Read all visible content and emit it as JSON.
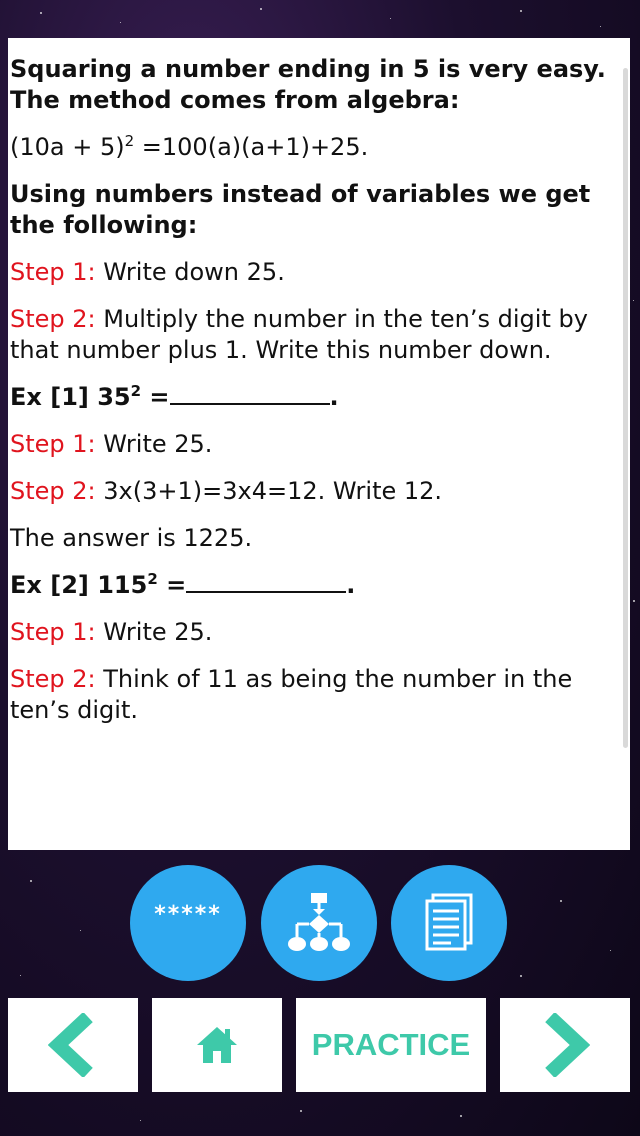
{
  "lesson": {
    "intro": "Squaring a number ending in 5 is very easy. The method comes from algebra:",
    "formula": {
      "lhs": "(10a + 5)",
      "exp": "2",
      "rhs": " =100(a)(a+1)+25."
    },
    "using_numbers": "Using numbers instead of variables we get the following:",
    "method_step1": {
      "label": "Step 1:",
      "text": " Write down 25."
    },
    "method_step2": {
      "label": "Step 2:",
      "text": " Multiply the number in the ten’s digit by that number plus 1. Write this number down."
    },
    "ex1": {
      "title": "Ex [1] 35",
      "exp": "2",
      "eq": " =",
      "end": "."
    },
    "ex1_step1": {
      "label": "Step 1:",
      "text": " Write 25."
    },
    "ex1_step2": {
      "label": "Step 2:",
      "text": " 3x(3+1)=3x4=12. Write 12."
    },
    "ex1_answer": "The answer is 1225.",
    "ex2": {
      "title": "Ex [2] 115",
      "exp": "2",
      "eq": " =",
      "end": "."
    },
    "ex2_step1": {
      "label": "Step 1:",
      "text": " Write 25."
    },
    "ex2_step2": {
      "label": "Step 2:",
      "text": " Think of 11 as being the number in the ten’s digit."
    }
  },
  "actions": {
    "rate_label": "*****"
  },
  "nav": {
    "practice_label": "PRACTICE"
  },
  "colors": {
    "accent_blue": "#2fa9ef",
    "accent_teal": "#3ec9a9",
    "step_red": "#e0141e"
  },
  "icons": [
    "star-rating-icon",
    "flowchart-icon",
    "documents-icon",
    "back-arrow-icon",
    "home-icon",
    "next-arrow-icon"
  ]
}
